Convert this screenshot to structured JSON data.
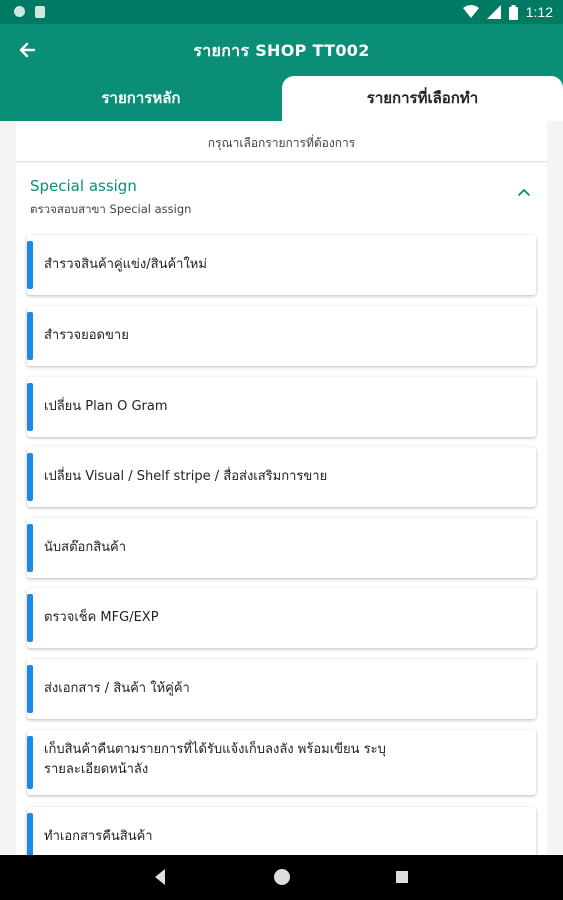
{
  "status_bar": {
    "time": "1:12"
  },
  "app_bar": {
    "title": "รายการ SHOP TT002"
  },
  "tabs": [
    {
      "label": "รายการหลัก"
    },
    {
      "label": "รายการที่เลือกทำ"
    }
  ],
  "hint": "กรุณาเลือกรายการที่ต้องการ",
  "section": {
    "title": "Special assign",
    "subtitle": "ตรวจสอบสาขา Special assign"
  },
  "items": [
    {
      "label": "สำรวจสินค้าคู่แข่ง/สินค้าใหม่"
    },
    {
      "label": "สำรวจยอดขาย"
    },
    {
      "label": "เปลี่ยน Plan O Gram"
    },
    {
      "label": "เปลี่ยน Visual / Shelf stripe / สื่อส่งเสริมการขาย"
    },
    {
      "label": "นับสต๊อกสินค้า"
    },
    {
      "label": "ตรวจเช็ค MFG/EXP"
    },
    {
      "label": "ส่งเอกสาร / สินค้า ให้คู่ค้า"
    },
    {
      "label": "เก็บสินค้าคืนตามรายการที่ได้รับแจ้งเก็บลงลัง พร้อมเขียน ระบุรายละเอียดหน้าลัง"
    },
    {
      "label": "ทำเอกสารคืนสินค้า"
    }
  ],
  "colors": {
    "primary": "#0a8f76",
    "status_bar": "#007a63",
    "accent": "#1e88e5"
  }
}
